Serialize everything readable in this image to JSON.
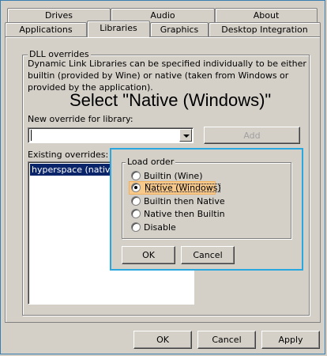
{
  "tabs_back": [
    "Drives",
    "Audio",
    "About"
  ],
  "tabs_front": [
    "Applications",
    "Libraries",
    "Graphics",
    "Desktop Integration"
  ],
  "dll": {
    "group_title": "DLL overrides",
    "description": "Dynamic Link Libraries can be specified individually to be either builtin (provided by Wine) or native (taken from Windows or provided by the application).",
    "instruction": "Select \"Native (Windows)\"",
    "new_override_label": "New override for library:",
    "new_override_value": "",
    "add_label": "Add",
    "existing_label": "Existing overrides:",
    "existing_items": [
      "hyperspace (native, b"
    ]
  },
  "load_order": {
    "title": "Load order",
    "options": [
      "Builtin (Wine)",
      "Native (Windows)",
      "Builtin then Native",
      "Native then Builtin",
      "Disable"
    ],
    "selected": "Native (Windows)",
    "ok_label": "OK",
    "cancel_label": "Cancel"
  },
  "footer": {
    "ok_label": "OK",
    "cancel_label": "Cancel",
    "apply_label": "Apply"
  },
  "colors": {
    "face": "#d4d0c8",
    "selection": "#0a246a",
    "dialog_outline": "#29a8e0",
    "option_highlight": "#f7c98b"
  }
}
